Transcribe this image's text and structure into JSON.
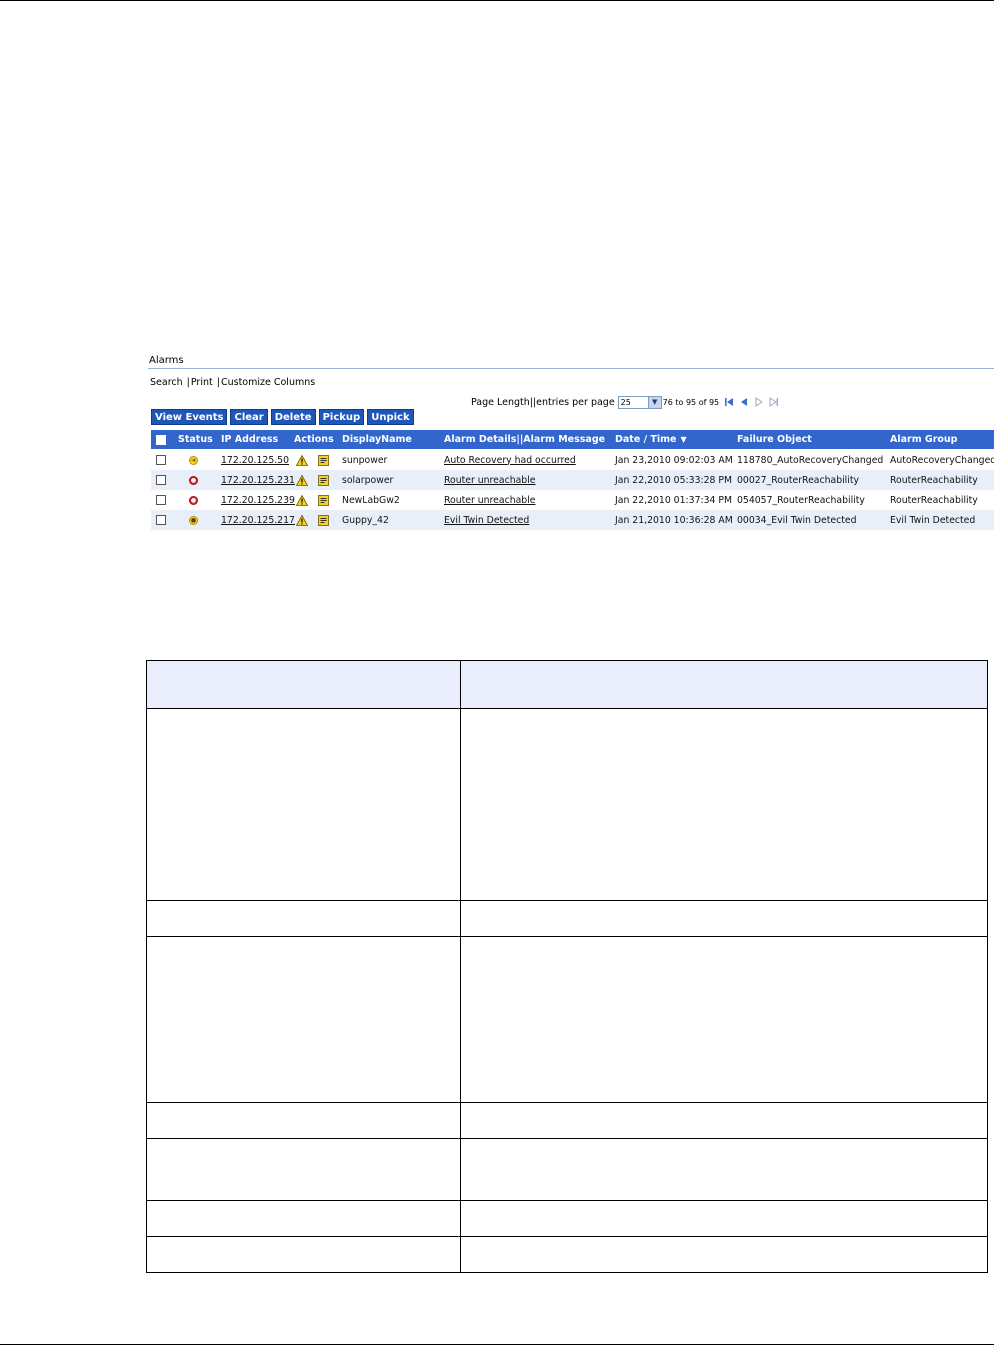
{
  "alarms": {
    "title": "Alarms",
    "links": [
      "Search",
      "Print",
      "Customize Columns"
    ],
    "pager": {
      "label": "Page Length||entries per page",
      "page_length": "25",
      "range": "76 to 95 of 95"
    },
    "buttons": [
      "View Events",
      "Clear",
      "Delete",
      "Pickup",
      "Unpick"
    ],
    "columns": {
      "status": "Status",
      "ip": "IP Address",
      "actions": "Actions",
      "display_name": "DisplayName",
      "details": "Alarm Details||Alarm Message",
      "datetime": "Date / Time",
      "failure_object": "Failure Object",
      "alarm_group": "Alarm Group"
    },
    "rows": [
      {
        "status": "yellow",
        "ip": "172.20.125.50",
        "display_name": "sunpower",
        "message": "Auto Recovery had occurred",
        "datetime": "Jan 23,2010 09:02:03 AM",
        "failure_object": "118780_AutoRecoveryChanged",
        "alarm_group": "AutoRecoveryChanged"
      },
      {
        "status": "red",
        "ip": "172.20.125.231",
        "display_name": "solarpower",
        "message": "Router unreachable",
        "datetime": "Jan 22,2010 05:33:28 PM",
        "failure_object": "00027_RouterReachability",
        "alarm_group": "RouterReachability"
      },
      {
        "status": "red",
        "ip": "172.20.125.239",
        "display_name": "NewLabGw2",
        "message": "Router unreachable",
        "datetime": "Jan 22,2010 01:37:34 PM",
        "failure_object": "054057_RouterReachability",
        "alarm_group": "RouterReachability"
      },
      {
        "status": "yellow",
        "ip": "172.20.125.217",
        "display_name": "Guppy_42",
        "message": "Evil Twin Detected",
        "datetime": "Jan 21,2010 10:36:28 AM",
        "failure_object": "00034_Evil Twin Detected",
        "alarm_group": "Evil Twin Detected"
      }
    ]
  },
  "colors": {
    "header_blue": "#3366cc",
    "button_blue": "#1f57b8",
    "row_alt": "#e9eff9",
    "table_header_fill": "#eaedfb"
  }
}
